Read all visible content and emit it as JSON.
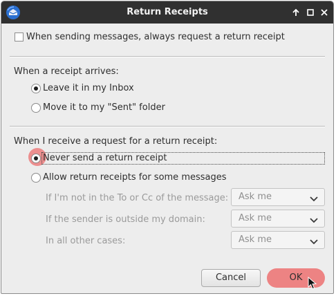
{
  "window": {
    "title": "Return Receipts"
  },
  "always_request": {
    "label": "When sending messages, always request a return receipt",
    "checked": false
  },
  "arrival": {
    "heading": "When a receipt arrives:",
    "options": [
      {
        "label": "Leave it in my Inbox",
        "checked": true
      },
      {
        "label": "Move it to my \"Sent\" folder",
        "checked": false
      }
    ]
  },
  "request": {
    "heading": "When I receive a request for a return receipt:",
    "options": [
      {
        "label": "Never send a return receipt",
        "checked": true
      },
      {
        "label": "Allow return receipts for some messages",
        "checked": false
      }
    ],
    "rules": [
      {
        "label": "If I'm not in the To or Cc of the message:",
        "value": "Ask me"
      },
      {
        "label": "If the sender is outside my domain:",
        "value": "Ask me"
      },
      {
        "label": "In all other cases:",
        "value": "Ask me"
      }
    ]
  },
  "buttons": {
    "cancel": "Cancel",
    "ok": "OK"
  },
  "icons": {
    "app": "thunderbird-icon",
    "cursor": "mouse-pointer-icon"
  }
}
